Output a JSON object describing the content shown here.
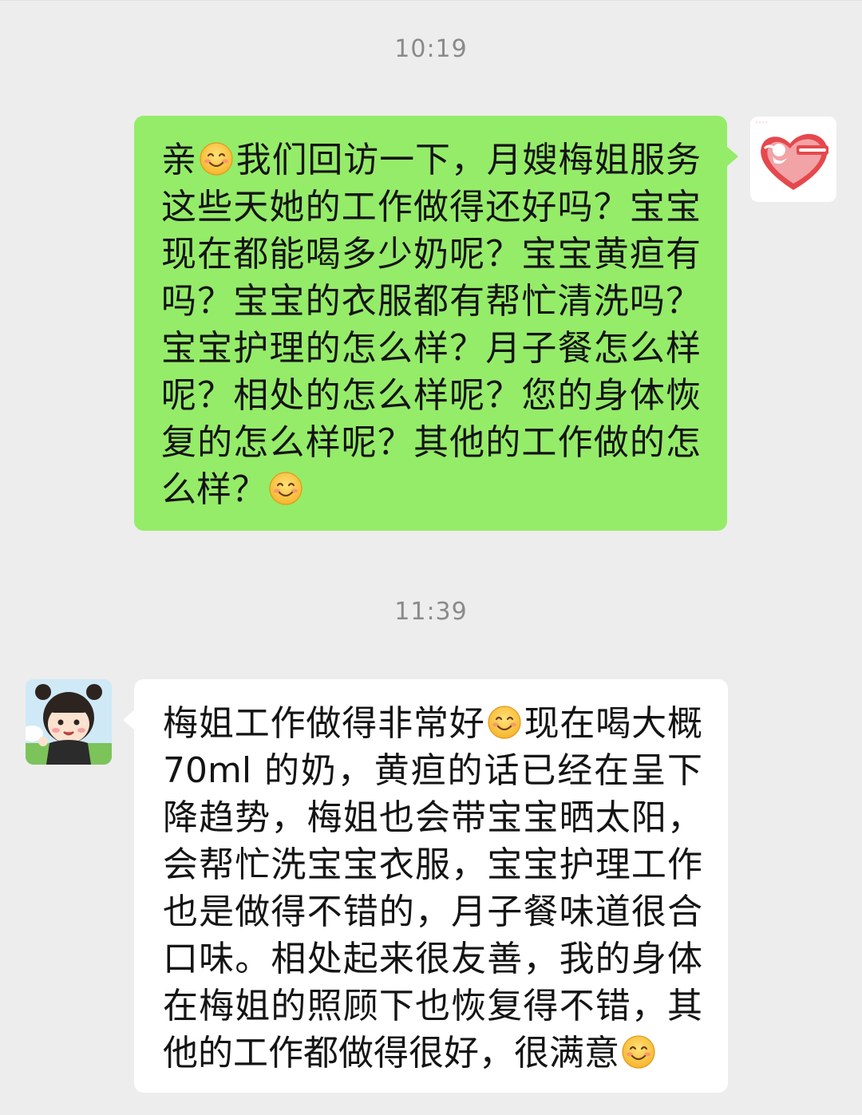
{
  "messages": [
    {
      "time": "10:19",
      "direction": "outgoing",
      "bubble_color": "#95ec69",
      "avatar": "heart-cupid-logo-avatar",
      "lines": [
        [
          "亲",
          "smile-emoji",
          "我们回访一下，月嫂梅姐服务"
        ],
        [
          "这些天她的工作做得还好吗？宝宝"
        ],
        [
          "现在都能喝多少奶呢？宝宝黄疸有"
        ],
        [
          "吗？宝宝的衣服都有帮忙清洗吗？"
        ],
        [
          "宝宝护理的怎么样？月子餐怎么样"
        ],
        [
          "呢？相处的怎么样呢？您的身体恢"
        ],
        [
          "复的怎么样呢？其他的工作做的怎"
        ],
        [
          "么样？",
          "smile-emoji"
        ]
      ]
    },
    {
      "time": "11:39",
      "direction": "incoming",
      "bubble_color": "#ffffff",
      "avatar": "cartoon-girl-avatar",
      "lines": [
        [
          "梅姐工作做得非常好",
          "smile-emoji",
          "现在喝大概"
        ],
        [
          "70ml 的奶，黄疸的话已经在呈下"
        ],
        [
          "降趋势，梅姐也会带宝宝晒太阳，"
        ],
        [
          "会帮忙洗宝宝衣服，宝宝护理工作"
        ],
        [
          "也是做得不错的，月子餐味道很合"
        ],
        [
          "口味。相处起来很友善，我的身体"
        ],
        [
          "在梅姐的照顾下也恢复得不错，其"
        ],
        [
          "他的工作都做得很好，很满意",
          "smile-emoji"
        ]
      ]
    }
  ],
  "colors": {
    "background": "#ededed",
    "timestamp": "#8a8a8a",
    "outgoing_bubble": "#95ec69",
    "incoming_bubble": "#ffffff",
    "avatar_heart": "#e5484d"
  }
}
